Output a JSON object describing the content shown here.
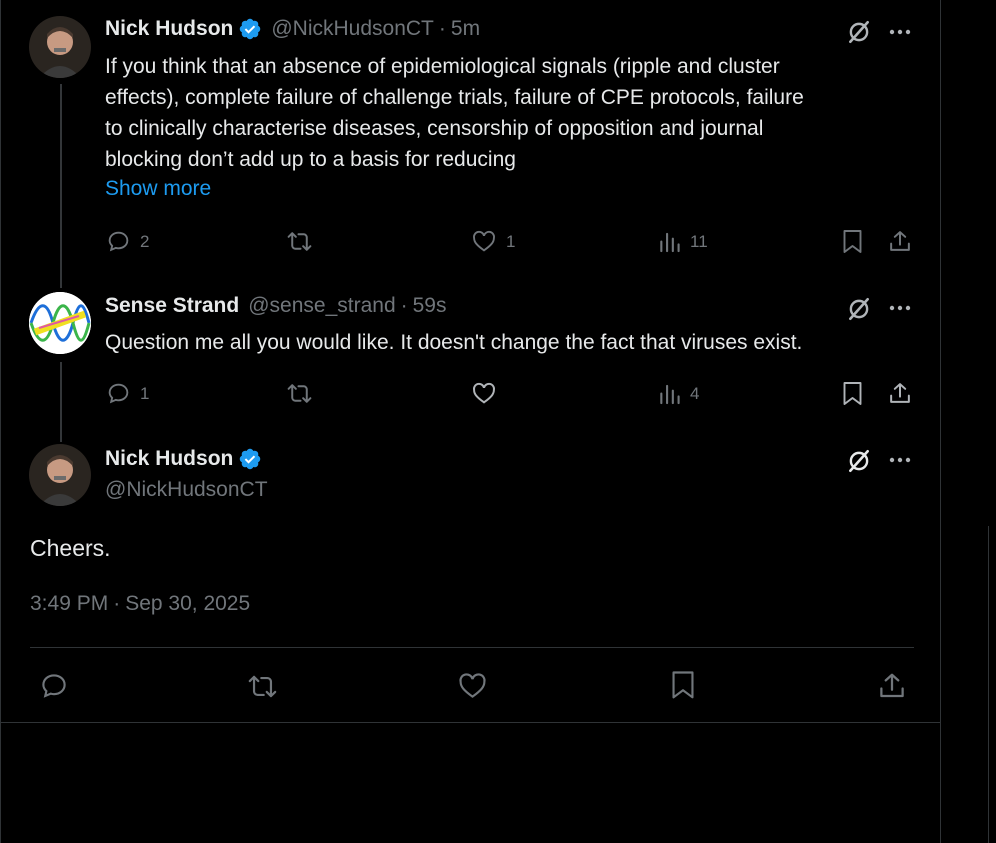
{
  "tweets": [
    {
      "name": "Nick Hudson",
      "handle": "@NickHudsonCT",
      "time": "5m",
      "sep": "·",
      "lines": [
        "If you think that an absence of epidemiological signals (ripple and cluster",
        "effects), complete failure of challenge trials, failure of CPE protocols, failure",
        "to clinically characterise diseases, censorship of opposition and journal",
        "blocking don’t add up to a basis for reducing"
      ],
      "show_more": "Show more",
      "replies": "2",
      "likes": "1",
      "views": "11"
    },
    {
      "name": "Sense Strand",
      "handle": "@sense_strand",
      "time": "59s",
      "sep": "·",
      "text": "Question me all you would like. It doesn't change the fact that viruses exist.",
      "replies": "1",
      "views": "4"
    }
  ],
  "main": {
    "name": "Nick Hudson",
    "handle": "@NickHudsonCT",
    "text": "Cheers.",
    "time": "3:49 PM",
    "sep": "·",
    "date": "Sep 30, 2025"
  },
  "colors": {
    "verified": "#1d9bf0",
    "link": "#1d9bf0",
    "muted": "#71767b"
  }
}
